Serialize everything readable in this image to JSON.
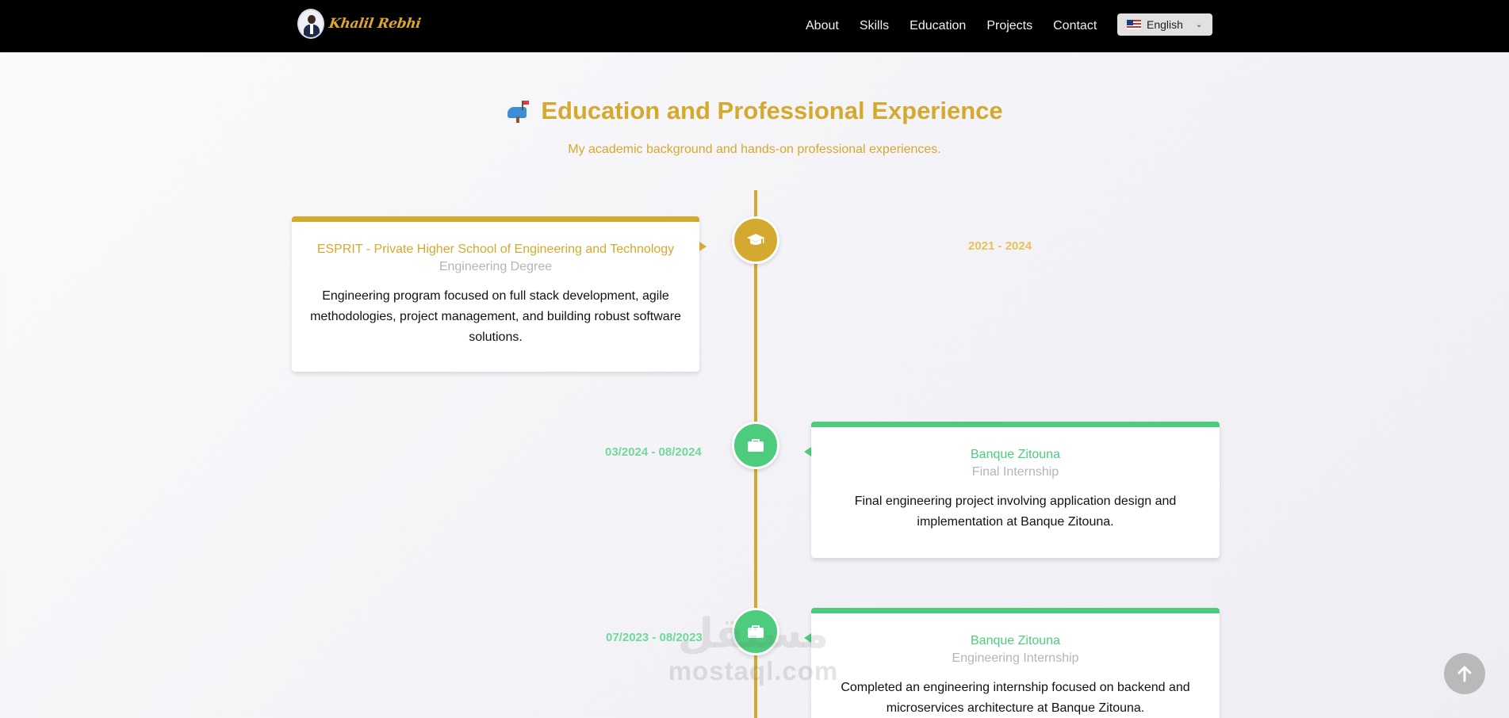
{
  "nav": {
    "brand_name": "Khalil Rebhi",
    "links": [
      "About",
      "Skills",
      "Education",
      "Projects",
      "Contact"
    ],
    "language": {
      "selected": "English",
      "icon": "us-flag-icon"
    }
  },
  "section": {
    "icon": "mailbox-icon",
    "title": "Education and Professional Experience",
    "subtitle": "My academic background and hands-on professional experiences."
  },
  "timeline": [
    {
      "kind": "education",
      "icon": "graduation-cap-icon",
      "organization": "ESPRIT - Private Higher School of Engineering and Technology",
      "role": "Engineering Degree",
      "description": "Engineering program focused on full stack development, agile methodologies, project management, and building robust software solutions.",
      "period": "2021 - 2024"
    },
    {
      "kind": "work",
      "icon": "briefcase-icon",
      "organization": "Banque Zitouna",
      "role": "Final Internship",
      "description": "Final engineering project involving application design and implementation at Banque Zitouna.",
      "period": "03/2024 - 08/2024"
    },
    {
      "kind": "work",
      "icon": "briefcase-icon",
      "organization": "Banque Zitouna",
      "role": "Engineering Internship",
      "description": "Completed an engineering internship focused on backend and microservices architecture at Banque Zitouna.",
      "period": "07/2023 - 08/2023"
    }
  ],
  "watermark": {
    "arabic": "مستقل",
    "latin": "mostaql.com"
  },
  "colors": {
    "gold": "#d4a92f",
    "green": "#4ccc7c",
    "navbar": "#000000"
  }
}
